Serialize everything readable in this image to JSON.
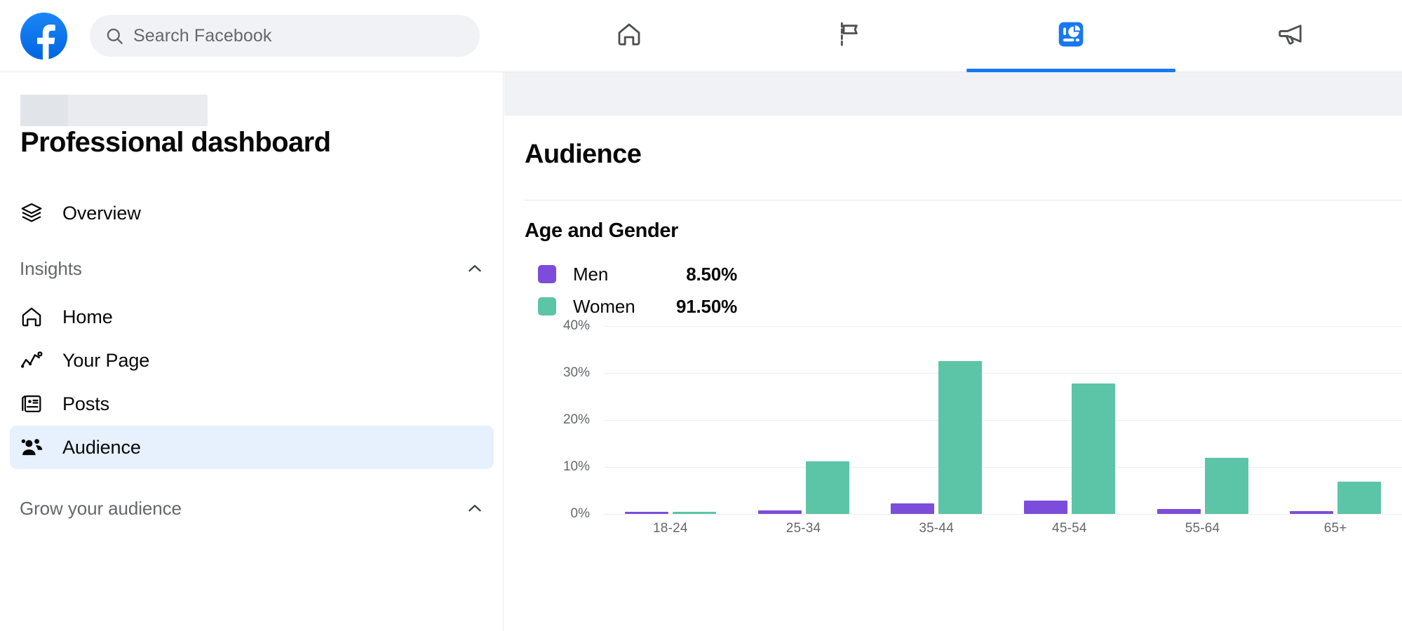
{
  "topbar": {
    "logo_label": "Facebook",
    "search": {
      "placeholder": "Search Facebook",
      "value": "",
      "icon": "search-icon"
    },
    "tabs": [
      {
        "id": "home",
        "icon": "home-icon",
        "label": "Home",
        "active": false
      },
      {
        "id": "pages",
        "icon": "flag-icon",
        "label": "Pages",
        "active": false
      },
      {
        "id": "professional-dashboard",
        "icon": "dashboard-gauge-icon",
        "label": "Professional dashboard",
        "active": true
      },
      {
        "id": "ads",
        "icon": "megaphone-icon",
        "label": "Ads",
        "active": false
      }
    ],
    "active_tab_color": "#1877f2"
  },
  "sidebar": {
    "redacted_placeholder": "",
    "title": "Professional dashboard",
    "items": [
      {
        "id": "overview",
        "icon": "layers-icon",
        "label": "Overview",
        "selected": false
      }
    ],
    "sections": [
      {
        "id": "insights",
        "label": "Insights",
        "chevron": "chevron-up-icon",
        "expanded": true,
        "items": [
          {
            "id": "home",
            "icon": "home-outline-icon",
            "label": "Home",
            "selected": false
          },
          {
            "id": "your-page",
            "icon": "trendline-icon",
            "label": "Your Page",
            "selected": false
          },
          {
            "id": "posts",
            "icon": "posts-icon",
            "label": "Posts",
            "selected": false
          },
          {
            "id": "audience",
            "icon": "people-group-icon",
            "label": "Audience",
            "selected": true
          }
        ]
      },
      {
        "id": "grow-your-audience",
        "label": "Grow your audience",
        "chevron": "chevron-up-icon",
        "expanded": true,
        "items": []
      }
    ],
    "selected_bg": "#e7f0fd"
  },
  "main": {
    "page_title": "Audience",
    "card_title": "Age and Gender"
  },
  "chart_data": {
    "type": "bar",
    "title": "Age and Gender",
    "xlabel": "",
    "ylabel": "",
    "categories": [
      "18-24",
      "25-34",
      "35-44",
      "45-54",
      "55-64",
      "65+"
    ],
    "series": [
      {
        "name": "Men",
        "color": "#7c4ddb",
        "total": "8.50%",
        "total_value": 8.5,
        "values": [
          0.4,
          0.8,
          2.3,
          2.9,
          1.1,
          0.6
        ]
      },
      {
        "name": "Women",
        "color": "#5cc4a7",
        "total": "91.50%",
        "total_value": 91.5,
        "values": [
          0.4,
          11.2,
          32.6,
          27.8,
          12.0,
          6.8
        ]
      }
    ],
    "ytick_labels": [
      "40%",
      "30%",
      "20%",
      "10%",
      "0%"
    ],
    "ytick_values": [
      40,
      30,
      20,
      10,
      0
    ],
    "ylim": [
      0,
      40
    ],
    "grid": true,
    "legend_position": "top-left",
    "legend": [
      {
        "label": "Men",
        "value": "8.50%",
        "color": "#7c4ddb"
      },
      {
        "label": "Women",
        "value": "91.50%",
        "color": "#5cc4a7"
      }
    ]
  }
}
